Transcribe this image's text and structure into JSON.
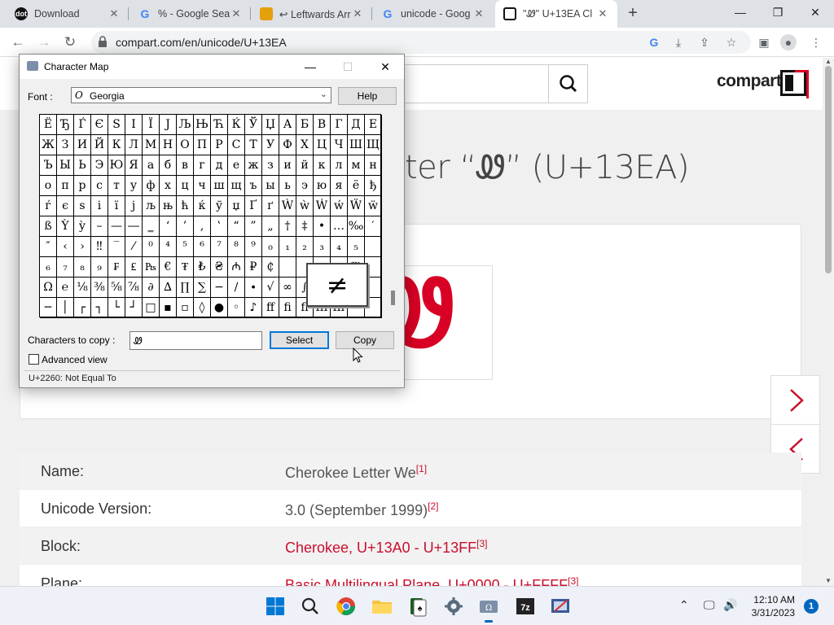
{
  "browser": {
    "tabs": [
      {
        "title": "Download",
        "favicon": "dotnet",
        "color": "#111111"
      },
      {
        "title": "% - Google Sea",
        "favicon": "G",
        "color": "#4285f4"
      },
      {
        "title": "↩ Leftwards Arr",
        "favicon": "bookmark",
        "color": "#e5a00d"
      },
      {
        "title": "unicode - Goog",
        "favicon": "G",
        "color": "#4285f4"
      },
      {
        "title": "\"Ꮺ\" U+13EA Cl",
        "favicon": "compart",
        "color": "#111111"
      }
    ],
    "new_tab": "+",
    "url": "compart.com/en/unicode/U+13EA"
  },
  "page": {
    "logo": "compart",
    "headline_fragment": "ter “Ꮺ” (U+13EA)",
    "glyph": "Ꮺ",
    "next_arrow": "next",
    "prev_arrow": "previous",
    "rows": [
      {
        "key": "Name:",
        "value": "Cherokee Letter We",
        "ref": "[1]",
        "link": false
      },
      {
        "key": "Unicode Version:",
        "value": "3.0 (September 1999)",
        "ref": "[2]",
        "link": false
      },
      {
        "key": "Block:",
        "value": "Cherokee, U+13A0 - U+13FF",
        "ref": "[3]",
        "link": true
      },
      {
        "key": "Plane:",
        "value": "Basic Multilingual Plane, U+0000 - U+FFFF",
        "ref": "[3]",
        "link": true
      }
    ]
  },
  "charmap": {
    "title": "Character Map",
    "font_label": "Font :",
    "font_value": "Georgia",
    "help": "Help",
    "grid": [
      [
        "Ё",
        "Ђ",
        "Ѓ",
        "Є",
        "S",
        "І",
        "Ї",
        "J",
        "Љ",
        "Њ",
        "Ћ",
        "Ќ",
        "Ў",
        "Џ",
        "А",
        "Б",
        "В",
        "Г",
        "Д",
        "Е"
      ],
      [
        "Ж",
        "З",
        "И",
        "Й",
        "К",
        "Л",
        "М",
        "Н",
        "О",
        "П",
        "Р",
        "С",
        "Т",
        "У",
        "Ф",
        "Х",
        "Ц",
        "Ч",
        "Ш",
        "Щ"
      ],
      [
        "Ъ",
        "Ы",
        "Ь",
        "Э",
        "Ю",
        "Я",
        "а",
        "б",
        "в",
        "г",
        "д",
        "е",
        "ж",
        "з",
        "и",
        "й",
        "к",
        "л",
        "м",
        "н"
      ],
      [
        "о",
        "п",
        "р",
        "с",
        "т",
        "у",
        "ф",
        "х",
        "ц",
        "ч",
        "ш",
        "щ",
        "ъ",
        "ы",
        "ь",
        "э",
        "ю",
        "я",
        "ё",
        "ђ"
      ],
      [
        "ѓ",
        "є",
        "s",
        "і",
        "ї",
        "j",
        "љ",
        "њ",
        "ћ",
        "ќ",
        "ў",
        "џ",
        "Ґ",
        "ґ",
        "Ẁ",
        "ẁ",
        "Ẃ",
        "ẃ",
        "Ẅ",
        "ẅ"
      ],
      [
        "ß",
        "Ỳ",
        "ỳ",
        "–",
        "—",
        "―",
        "‗",
        "‘",
        "’",
        "‚",
        "‛",
        "“",
        "”",
        "„",
        "†",
        "‡",
        "•",
        "…",
        "‰",
        "′"
      ],
      [
        "″",
        "‹",
        "›",
        "‼",
        "‾",
        "⁄",
        "⁰",
        "⁴",
        "⁵",
        "⁶",
        "⁷",
        "⁸",
        "⁹",
        "₀",
        "₁",
        "₂",
        "₃",
        "₄",
        "₅",
        ""
      ],
      [
        "₆",
        "₇",
        "₈",
        "₉",
        "₣",
        "₤",
        "₧",
        "€",
        "₮",
        "₺",
        "₴",
        "₼",
        "₽",
        "₵",
        "",
        "",
        "",
        "",
        "™",
        ""
      ],
      [
        "Ω",
        "℮",
        "⅛",
        "⅜",
        "⅝",
        "⅞",
        "∂",
        "∆",
        "∏",
        "∑",
        "−",
        "∕",
        "∙",
        "√",
        "∞",
        "∫",
        "",
        "",
        "≥",
        ""
      ],
      [
        "─",
        "│",
        "┌",
        "┐",
        "└",
        "┘",
        "□",
        "▪",
        "▫",
        "◊",
        "●",
        "◦",
        "♪",
        "ﬀ",
        "ﬁ",
        "ﬂ",
        "ﬃ",
        "ﬄ",
        "",
        ""
      ]
    ],
    "zoom_char": "≠",
    "copy_label": "Characters to copy :",
    "copy_value": "Ꮺ",
    "select": "Select",
    "copy": "Copy",
    "advanced": "Advanced view",
    "status": "U+2260: Not Equal To"
  },
  "taskbar": {
    "time": "12:10 AM",
    "date": "3/31/2023",
    "notifications": "1"
  }
}
